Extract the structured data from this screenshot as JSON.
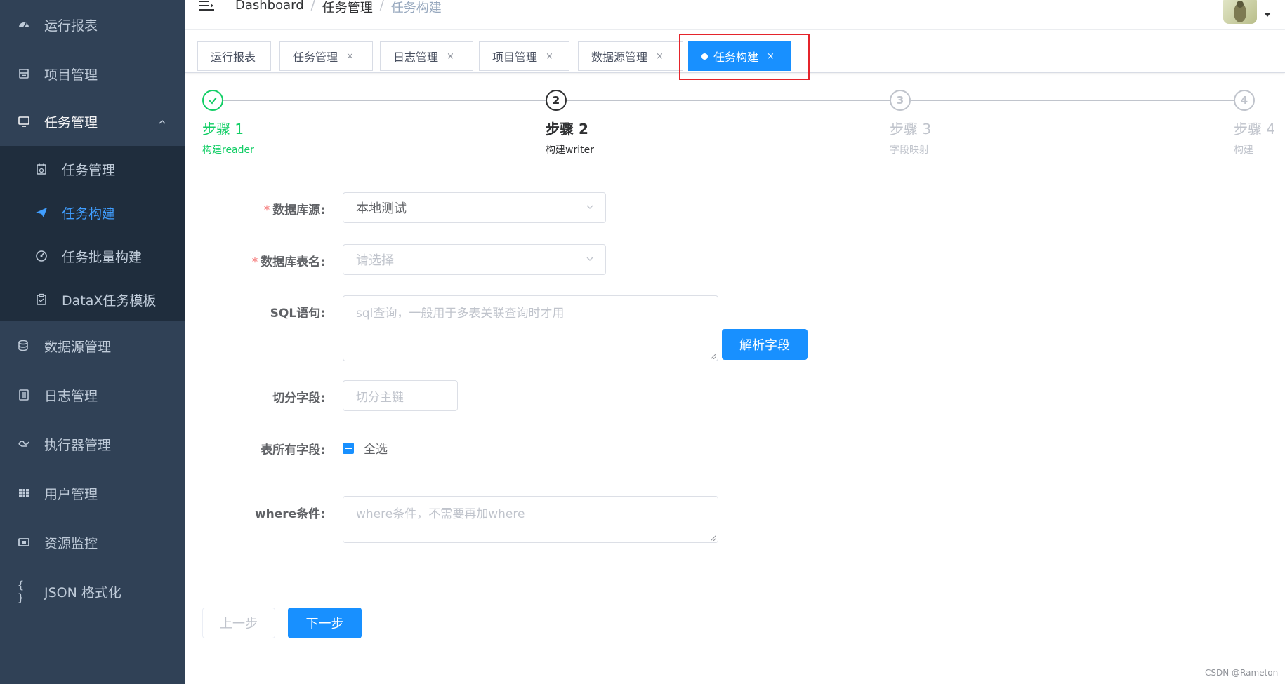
{
  "sidebar": {
    "items": [
      {
        "label": "运行报表",
        "icon": "dashboard-icon"
      },
      {
        "label": "项目管理",
        "icon": "project-icon"
      },
      {
        "label": "任务管理",
        "icon": "monitor-icon"
      },
      {
        "label": "数据源管理",
        "icon": "database-icon"
      },
      {
        "label": "日志管理",
        "icon": "document-icon"
      },
      {
        "label": "执行器管理",
        "icon": "executor-icon"
      },
      {
        "label": "用户管理",
        "icon": "table-icon"
      },
      {
        "label": "资源监控",
        "icon": "monitor-resource-icon"
      },
      {
        "label": "JSON 格式化",
        "icon": "code-braces-icon"
      }
    ],
    "submenu": [
      {
        "label": "任务管理",
        "icon": "calendar-icon"
      },
      {
        "label": "任务构建",
        "icon": "paper-plane-icon",
        "active": true
      },
      {
        "label": "任务批量构建",
        "icon": "gauge-icon"
      },
      {
        "label": "DataX任务模板",
        "icon": "clipboard-icon"
      }
    ],
    "bg_color": "#304156",
    "submenu_bg_color": "#1f2d3d",
    "active_color": "#409eff"
  },
  "navbar": {
    "breadcrumb": [
      "Dashboard",
      "任务管理",
      "任务构建"
    ],
    "separator": "/"
  },
  "tags": [
    {
      "label": "运行报表",
      "closable": false
    },
    {
      "label": "任务管理",
      "closable": true
    },
    {
      "label": "日志管理",
      "closable": true
    },
    {
      "label": "项目管理",
      "closable": true
    },
    {
      "label": "数据源管理",
      "closable": true
    },
    {
      "label": "任务构建",
      "closable": true,
      "active": true
    }
  ],
  "close_glyph": "×",
  "steps": [
    {
      "number": "1",
      "title": "步骤 1",
      "description": "构建reader",
      "status": "done"
    },
    {
      "number": "2",
      "title": "步骤 2",
      "description": "构建writer",
      "status": "process"
    },
    {
      "number": "3",
      "title": "步骤 3",
      "description": "字段映射",
      "status": "wait"
    },
    {
      "number": "4",
      "title": "步骤 4",
      "description": "构建",
      "status": "wait"
    }
  ],
  "form": {
    "required_mark": "*",
    "datasource": {
      "label": "数据库源:",
      "value": "本地测试"
    },
    "table_name": {
      "label": "数据库表名:",
      "placeholder": "请选择"
    },
    "sql": {
      "label": "SQL语句:",
      "placeholder": "sql查询，一般用于多表关联查询时才用"
    },
    "parse_button": "解析字段",
    "split_field": {
      "label": "切分字段:",
      "placeholder": "切分主键"
    },
    "all_fields": {
      "label": "表所有字段:",
      "checkbox_label": "全选"
    },
    "where": {
      "label": "where条件:",
      "placeholder": "where条件，不需要再加where"
    }
  },
  "buttons": {
    "prev": "上一步",
    "next": "下一步"
  },
  "watermark": "CSDN @Rameton",
  "colors": {
    "primary": "#1890ff",
    "success": "#13ce66",
    "danger": "#f56c6c",
    "highlight": "#e5242b"
  }
}
